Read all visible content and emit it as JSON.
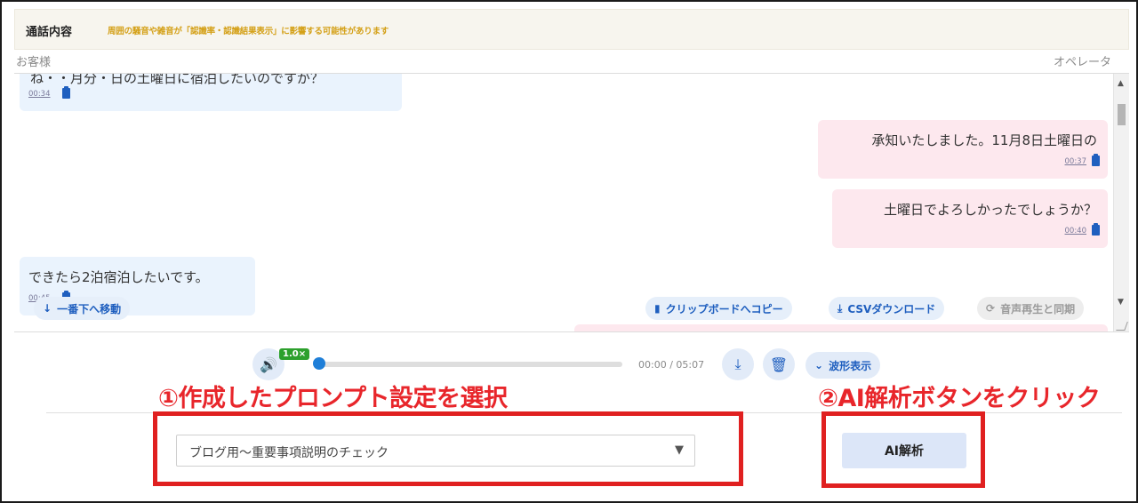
{
  "header": {
    "title": "通話内容",
    "notice": "周囲の騒音や雑音が「認識率・認識結果表示」に影響する可能性があります"
  },
  "labels": {
    "customer": "お客様",
    "operator": "オペレータ"
  },
  "messages": [
    {
      "speaker": "customer",
      "text": "ね・・月分・日の土曜日に宿泊したいのですが？",
      "time": "00:34"
    },
    {
      "speaker": "operator",
      "text": "承知いたしました。11月8日土曜日の",
      "time": "00:37"
    },
    {
      "speaker": "operator",
      "text": "土曜日でよろしかったでしょうか？",
      "time": "00:40"
    },
    {
      "speaker": "customer",
      "text": "できたら2泊宿泊したいです。",
      "time": "00:45"
    }
  ],
  "chat_actions": {
    "scroll_bottom": "一番下へ移動",
    "copy_clipboard": "クリップボードへコピー",
    "csv_download": "CSVダウンロード",
    "sync_audio": "音声再生と同期"
  },
  "player": {
    "speed": "1.0×",
    "progress": 0,
    "time": "00:00 / 05:07",
    "waveform": "波形表示"
  },
  "steps": {
    "step1": "①作成したプロンプト設定を選択",
    "step2": "②AI解析ボタンをクリック"
  },
  "prompt_select": {
    "value": "ブログ用～重要事項説明のチェック"
  },
  "ai_button": {
    "label": "AI解析"
  },
  "colors": {
    "accent": "#1f5fbf",
    "customer_bubble": "#eaf3fd",
    "operator_bubble": "#fde8ee",
    "annotation_red": "#e02020",
    "notice_gold": "#d4a017",
    "speed_green": "#2ca02c"
  },
  "icons": {
    "clipboard": "clipboard-icon",
    "download": "download-icon",
    "sync": "sync-icon",
    "speaker": "volume-icon",
    "trash": "trash-icon",
    "chevron": "chevron-down-icon",
    "arrow_down": "arrow-down-icon"
  }
}
